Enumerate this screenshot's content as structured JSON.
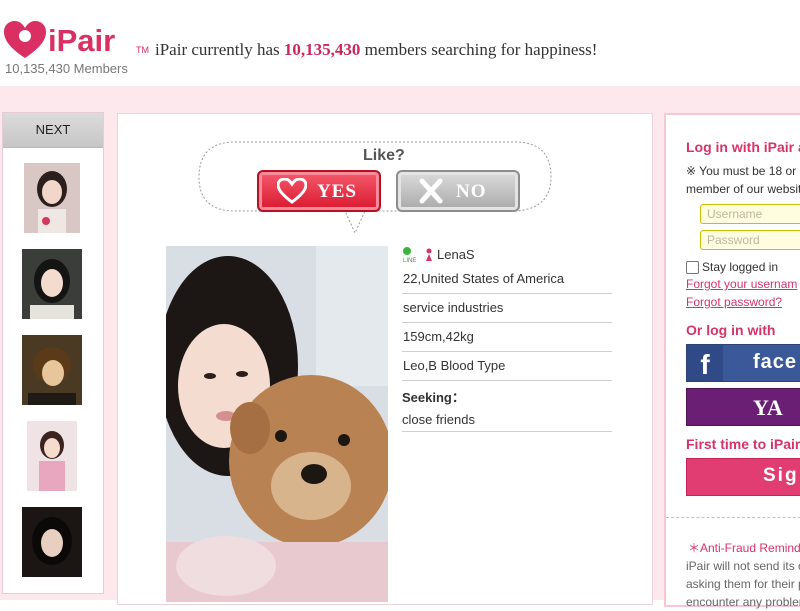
{
  "header": {
    "logo_text": "iPair",
    "logo_tm": "TM",
    "tagline_prefix": "iPair currently has",
    "tagline_count": "10,135,430",
    "tagline_suffix": "members searching for happiness!",
    "members_line": "10,135,430 Members"
  },
  "sidebar": {
    "next_label": "NEXT"
  },
  "like": {
    "title": "Like?",
    "yes_label": "YES",
    "no_label": "NO"
  },
  "profile": {
    "name": "LenaS",
    "online_label": "LINE",
    "age_location": "22,United States of America",
    "occupation": "service industries",
    "body": "159cm,42kg",
    "sign_blood": "Leo,B Blood Type",
    "seeking_label": "Seeking：",
    "seeking_value": "close friends"
  },
  "login": {
    "title": "Log in with iPair a",
    "notice_line1": "※ You must be 18 or",
    "notice_line2": "member of our websit",
    "username_placeholder": "Username",
    "password_placeholder": "Password",
    "stay_logged_in": "Stay logged in",
    "forgot_username": "Forgot your usernam",
    "forgot_password": "Forgot password?",
    "or_login_with": "Or log in with",
    "facebook_label": "face",
    "facebook_icon": "f",
    "yahoo_label": "YA",
    "first_time": "First time to iPair",
    "signup_label": "Sig"
  },
  "fraud": {
    "title": "＊Anti-Fraud Reminde",
    "line1": "iPair will not send its c",
    "line2": "asking them for their p",
    "line3": "encounter any probler"
  },
  "colors": {
    "brand_pink": "#d6336c",
    "count_pink": "#c8285a",
    "facebook_blue": "#3b5998",
    "yahoo_purple": "#6a1e74",
    "page_bg": "#fde8ee"
  }
}
